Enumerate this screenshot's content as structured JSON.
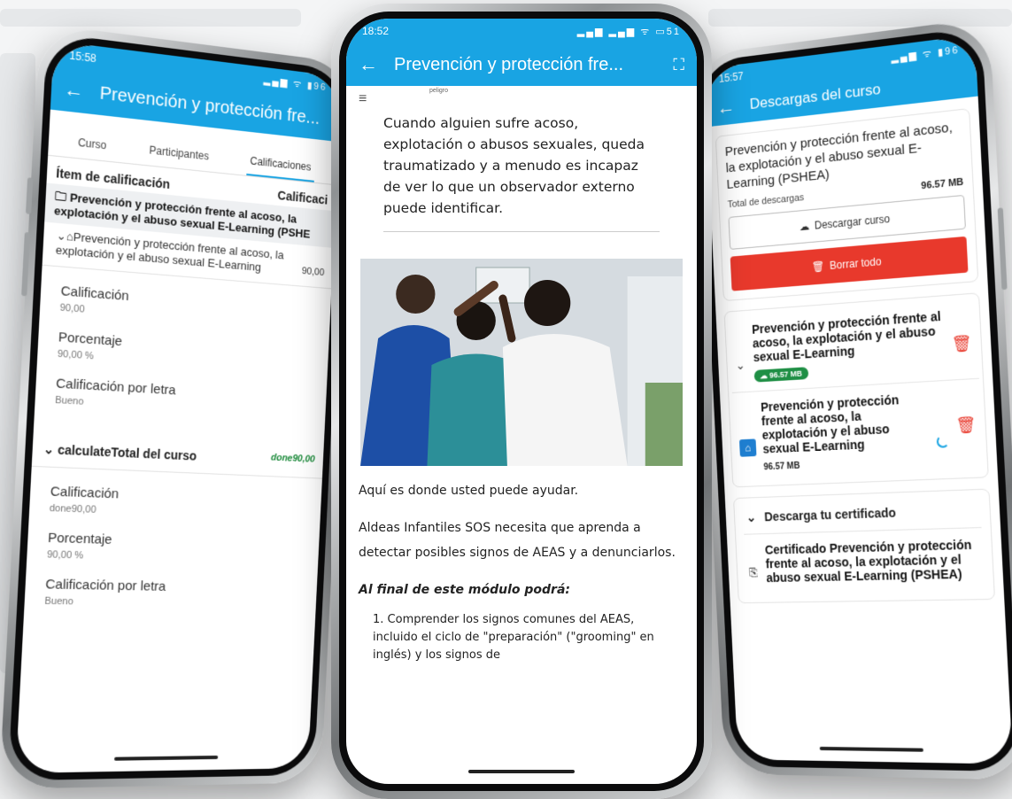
{
  "left": {
    "status_time": "15:58",
    "status_icons": "▂▄▆ ᯤ ▮96",
    "title": "Prevención y protección fre...",
    "tabs": [
      "Curso",
      "Participantes",
      "Calificaciones"
    ],
    "grade_header": {
      "item": "Ítem de calificación",
      "grade": "Calificaci"
    },
    "category": "Prevención y protección frente al acoso, la explotación y el abuso sexual E-Learning (PSHE",
    "item": {
      "label": "Prevención y protección frente al acoso, la explotación y el abuso sexual E-Learning",
      "value": "90,00"
    },
    "fields1": [
      {
        "label": "Calificación",
        "value": "90,00"
      },
      {
        "label": "Porcentaje",
        "value": "90,00 %"
      },
      {
        "label": "Calificación por letra",
        "value": "Bueno"
      }
    ],
    "total": {
      "label": "calculateTotal del curso",
      "value": "done90,00"
    },
    "fields2": [
      {
        "label": "Calificación",
        "value": "done90,00"
      },
      {
        "label": "Porcentaje",
        "value": "90,00 %"
      },
      {
        "label": "Calificación por letra",
        "value": "Bueno"
      }
    ]
  },
  "center": {
    "status_time": "18:52",
    "status_icons": "▂▄▆ ▂▄▆ ᯤ ▭51",
    "title": "Prevención y protección fre...",
    "tiny_word": "peligro",
    "quote": "Cuando alguien sufre acoso, explotación o abusos sexuales, queda traumatizado y a menudo es incapaz de ver lo que un observador externo puede identificar.",
    "p1": "Aquí es donde usted puede ayudar.",
    "p2": "Aldeas Infantiles SOS necesita que aprenda a detectar posibles signos de AEAS y a denunciarlos.",
    "subheading": "Al final de este módulo podrá:",
    "list_item": "1. Comprender los signos comunes del AEAS, incluido el ciclo de \"preparación\" (\"grooming\" en inglés) y los signos de"
  },
  "right": {
    "status_time": "15:57",
    "status_icons": "▂▄▆ ᯤ ▮96",
    "title": "Descargas del curso",
    "course_title": "Prevención y protección frente al acoso, la explotación y el abuso sexual E-Learning (PSHEA)",
    "total_label": "Total de descargas",
    "total_size": "96.57 MB",
    "download_button": "Descargar curso",
    "delete_button": "Borrar todo",
    "module1": {
      "title": "Prevención y protección frente al acoso, la explotación y el abuso sexual E-Learning",
      "badge": "96.57 MB"
    },
    "module2": {
      "title": "Prevención y protección frente al acoso, la explotación y el abuso sexual E-Learning",
      "size": "96.57 MB"
    },
    "cert_header": "Descarga tu certificado",
    "cert_title": "Certificado Prevención y protección frente al acoso, la explotación y el abuso sexual E-Learning (PSHEA)"
  },
  "colors": {
    "appbar": "#19a4e3",
    "delete": "#e8392c",
    "badge": "#1f8f45"
  }
}
